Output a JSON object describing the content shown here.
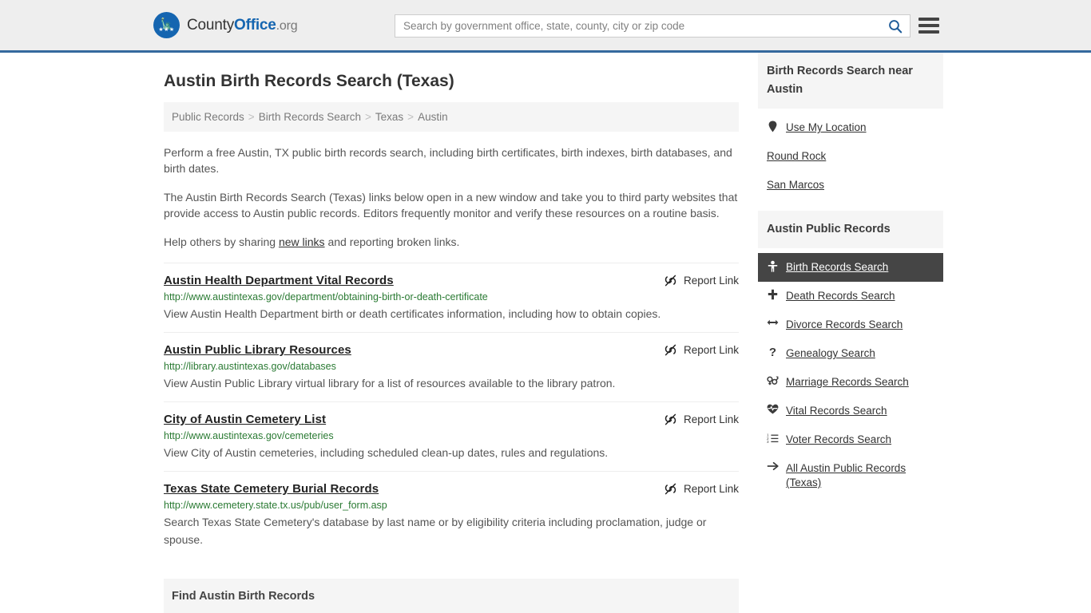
{
  "header": {
    "logo": {
      "part1": "County",
      "part2": "Office",
      "part3": ".org",
      "icon": "eagle-seal-icon"
    },
    "search": {
      "placeholder": "Search by government office, state, county, city or zip code",
      "value": "",
      "button_icon": "search-icon"
    },
    "menu_icon": "hamburger-menu-icon",
    "accent_color": "#35699e"
  },
  "page": {
    "title": "Austin Birth Records Search (Texas)",
    "breadcrumb": [
      {
        "label": "Public Records"
      },
      {
        "label": "Birth Records Search"
      },
      {
        "label": "Texas"
      },
      {
        "label": "Austin"
      }
    ],
    "breadcrumb_separator": ">",
    "intro_1": "Perform a free Austin, TX public birth records search, including birth certificates, birth indexes, birth databases, and birth dates.",
    "intro_2": "The Austin Birth Records Search (Texas) links below open in a new window and take you to third party websites that provide access to Austin public records. Editors frequently monitor and verify these resources on a routine basis.",
    "intro_3_pre": "Help others by sharing ",
    "intro_3_link": "new links",
    "intro_3_post": " and reporting broken links."
  },
  "report_link_label": "Report Link",
  "report_link_icon": "broken-chain-icon",
  "results": [
    {
      "title": "Austin Health Department Vital Records",
      "url": "http://www.austintexas.gov/department/obtaining-birth-or-death-certificate",
      "description": "View Austin Health Department birth or death certificates information, including how to obtain copies."
    },
    {
      "title": "Austin Public Library Resources",
      "url": "http://library.austintexas.gov/databases",
      "description": "View Austin Public Library virtual library for a list of resources available to the library patron."
    },
    {
      "title": "City of Austin Cemetery List",
      "url": "http://www.austintexas.gov/cemeteries",
      "description": "View City of Austin cemeteries, including scheduled clean-up dates, rules and regulations."
    },
    {
      "title": "Texas State Cemetery Burial Records",
      "url": "http://www.cemetery.state.tx.us/pub/user_form.asp",
      "description": "Search Texas State Cemetery's database by last name or by eligibility criteria including proclamation, judge or spouse."
    }
  ],
  "bottom_panel": {
    "title": "Find Austin Birth Records"
  },
  "sidebar": {
    "near_panel": {
      "title": "Birth Records Search near Austin",
      "items": [
        {
          "label": "Use My Location",
          "icon": "map-pin-icon"
        },
        {
          "label": "Round Rock",
          "icon": ""
        },
        {
          "label": "San Marcos",
          "icon": ""
        }
      ]
    },
    "records_panel": {
      "title": "Austin Public Records",
      "items": [
        {
          "label": "Birth Records Search",
          "icon": "baby-icon",
          "active": true
        },
        {
          "label": "Death Records Search",
          "icon": "cross-icon",
          "active": false
        },
        {
          "label": "Divorce Records Search",
          "icon": "arrows-left-right-icon",
          "active": false
        },
        {
          "label": "Genealogy Search",
          "icon": "question-mark-icon",
          "active": false
        },
        {
          "label": "Marriage Records Search",
          "icon": "venus-mars-icon",
          "active": false
        },
        {
          "label": "Vital Records Search",
          "icon": "heart-pulse-icon",
          "active": false
        },
        {
          "label": "Voter Records Search",
          "icon": "ordered-list-icon",
          "active": false
        },
        {
          "label": "All Austin Public Records (Texas)",
          "icon": "arrow-right-icon",
          "active": false
        }
      ],
      "active_bg": "#454545"
    }
  }
}
